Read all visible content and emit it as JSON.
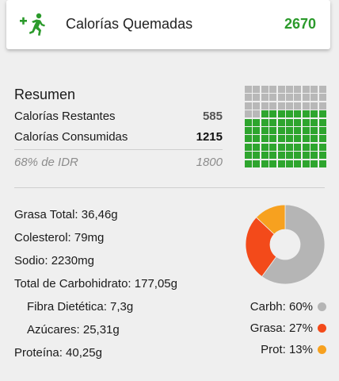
{
  "burned": {
    "label": "Calorías Quemadas",
    "value": "2670",
    "icon": "running-plus-icon",
    "color": "#2b9a2b"
  },
  "summary": {
    "title": "Resumen",
    "remaining_label": "Calorías Restantes",
    "remaining_value": "585",
    "consumed_label": "Calorías Consumidas",
    "consumed_value": "1215",
    "idr_label": "68% de IDR",
    "idr_value": "1800"
  },
  "waffle": {
    "total_cells": 100,
    "filled_cells": 68,
    "filled_color": "#2ea52e",
    "empty_color": "#b8b8b8"
  },
  "nutrients": [
    {
      "label": "Grasa Total: 36,46g",
      "indent": false
    },
    {
      "label": "Colesterol: 79mg",
      "indent": false
    },
    {
      "label": "Sodio: 2230mg",
      "indent": false
    },
    {
      "label": "Total de Carbohidrato: 177,05g",
      "indent": false
    },
    {
      "label": "Fibra Dietética: 7,3g",
      "indent": true
    },
    {
      "label": "Azúcares: 25,31g",
      "indent": true
    },
    {
      "label": "Proteína: 40,25g",
      "indent": false
    }
  ],
  "chart_data": {
    "type": "pie",
    "categories": [
      "Carbh",
      "Grasa",
      "Prot"
    ],
    "values": [
      60,
      27,
      13
    ],
    "colors": [
      "#b5b5b5",
      "#f34a1a",
      "#f7a11f"
    ]
  },
  "legend": [
    {
      "label": "Carbh: 60%",
      "color": "#b5b5b5"
    },
    {
      "label": "Grasa: 27%",
      "color": "#f34a1a"
    },
    {
      "label": "Prot: 13%",
      "color": "#f7a11f"
    }
  ]
}
